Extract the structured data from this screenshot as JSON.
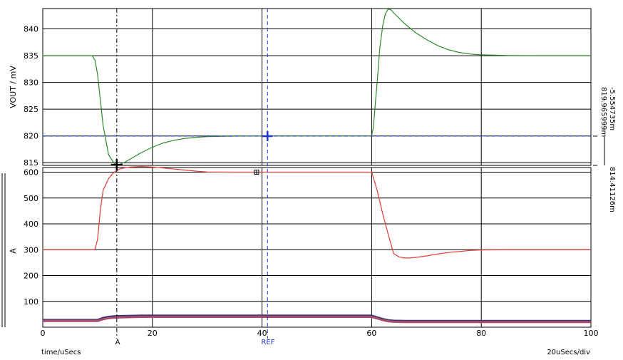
{
  "chart_data": [
    {
      "type": "line",
      "panel": "top",
      "title": "",
      "xlabel": "time/uSecs",
      "ylabel": "VOUT / mV",
      "xlim": [
        0,
        100
      ],
      "ylim": [
        814.5,
        843.8
      ],
      "yticks": [
        815,
        820,
        825,
        830,
        835,
        840
      ],
      "grid": true,
      "series": [
        {
          "color": "#2a8a2a",
          "x": [
            0,
            9,
            9.5,
            10,
            11,
            12,
            13,
            13.5,
            14,
            15,
            16,
            18,
            20,
            22,
            24,
            26,
            28,
            30,
            33,
            36,
            40,
            45,
            50,
            55,
            60,
            60.3,
            61,
            61.5,
            62,
            62.5,
            63,
            63.5,
            64,
            65,
            66,
            68,
            70,
            72,
            74,
            76,
            78,
            80,
            85,
            90,
            95,
            100
          ],
          "y": [
            835,
            835,
            834.2,
            831.5,
            822,
            816.5,
            814.9,
            814.6,
            814.7,
            815.1,
            815.7,
            816.9,
            817.9,
            818.7,
            819.2,
            819.55,
            819.75,
            819.87,
            819.95,
            819.98,
            820,
            820,
            820,
            820,
            820,
            821.5,
            830,
            836.5,
            840.5,
            842.8,
            843.7,
            843.6,
            843,
            842,
            841,
            839.3,
            838,
            836.9,
            836.1,
            835.6,
            835.3,
            835.15,
            835.02,
            835,
            835,
            835
          ]
        }
      ],
      "cursors": [
        {
          "label": "A",
          "x": 13.5,
          "y": 814.41126
        },
        {
          "label": "REF",
          "x": 41,
          "y": 819.965999
        }
      ],
      "cursor_readouts": [
        "819.965999m",
        "-5.554735m",
        "814.41126m"
      ]
    },
    {
      "type": "line",
      "panel": "bottom",
      "xlabel": "time/uSecs",
      "ylabel": "A",
      "xlim": [
        0,
        100
      ],
      "ylim": [
        0,
        618
      ],
      "yticks": [
        100,
        200,
        300,
        400,
        500,
        600
      ],
      "xticks": [
        0,
        20,
        40,
        60,
        80,
        100
      ],
      "x_divisions": "20uSecs/div",
      "grid": true,
      "series": [
        {
          "color": "#e23b3b",
          "x": [
            0,
            9.5,
            10,
            10.5,
            11,
            12,
            13,
            14,
            15,
            16,
            18,
            20,
            22,
            24,
            26,
            28,
            30,
            35,
            40,
            45,
            50,
            55,
            60,
            61,
            62,
            63,
            64,
            65,
            66,
            67,
            68,
            70,
            72,
            74,
            76,
            78,
            80,
            85,
            90,
            95,
            100
          ],
          "y": [
            300,
            300,
            340,
            450,
            530,
            575,
            600,
            612,
            617,
            620,
            622,
            620,
            616,
            612,
            608,
            604,
            601,
            600,
            600,
            600,
            600,
            600,
            600,
            530,
            440,
            360,
            285,
            272,
            268,
            268,
            270,
            276,
            283,
            289,
            293,
            297,
            299,
            300,
            300,
            300,
            300
          ]
        },
        {
          "color": "#3a3a7a",
          "x": [
            0,
            10,
            11,
            12,
            13,
            14,
            16,
            18,
            20,
            25,
            30,
            40,
            50,
            55,
            60,
            61,
            62,
            63,
            64,
            66,
            70,
            80,
            90,
            100
          ],
          "y": [
            28,
            28,
            36,
            40,
            42,
            43,
            44,
            45,
            45,
            45,
            45,
            45,
            45,
            45,
            45,
            38,
            32,
            27,
            25,
            24,
            24,
            24,
            24,
            24
          ]
        },
        {
          "color": "#b04a6a",
          "x": [
            0,
            10,
            11,
            12,
            13,
            14,
            16,
            18,
            20,
            25,
            30,
            40,
            50,
            55,
            60,
            61,
            62,
            63,
            64,
            66,
            70,
            80,
            90,
            100
          ],
          "y": [
            24,
            24,
            31,
            35,
            37,
            38,
            39,
            40,
            40,
            40,
            40,
            40,
            40,
            40,
            40,
            34,
            28,
            23,
            21,
            20,
            20,
            20,
            20,
            20
          ]
        }
      ],
      "marker": {
        "x": 39,
        "y": 600
      }
    }
  ],
  "labels": {
    "cursor_a": "A",
    "cursor_ref": "REF",
    "xlabel": "time/uSecs",
    "xdiv": "20uSecs/div",
    "readout_1": "819.965999m",
    "readout_2": "-5.554735m",
    "readout_3": "814.41126m"
  }
}
